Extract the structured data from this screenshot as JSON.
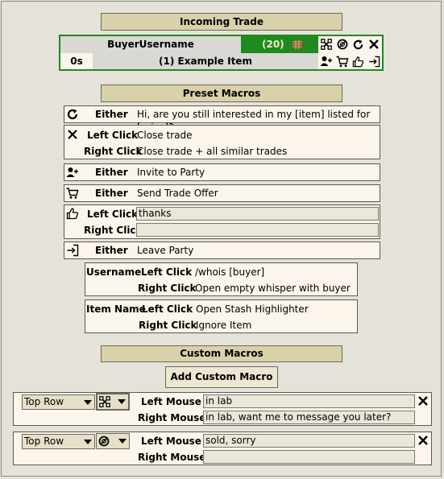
{
  "incoming": {
    "title": "Incoming Trade",
    "buyer": "BuyerUsername",
    "count": "(20)",
    "timer": "0s",
    "item": "(1) Example Item"
  },
  "preset": {
    "title": "Preset Macros",
    "rows": [
      {
        "icon": "refresh-icon",
        "trigger": "Either",
        "text": "Hi, are you still interested in my [item] listed for [price]?"
      },
      {
        "icon": "close-icon",
        "left": "Left Click",
        "left_text": "Close trade",
        "right": "Right Click",
        "right_text": "Close trade + all similar trades"
      },
      {
        "icon": "invite-icon",
        "trigger": "Either",
        "text": "Invite to Party"
      },
      {
        "icon": "cart-icon",
        "trigger": "Either",
        "text": "Send Trade Offer"
      },
      {
        "icon": "thumbs-up-icon",
        "left": "Left Click",
        "left_value": "thanks",
        "right": "Right Click",
        "right_value": ""
      },
      {
        "icon": "leave-icon",
        "trigger": "Either",
        "text": "Leave Party"
      }
    ],
    "username": {
      "label": "Username",
      "left": "Left Click",
      "left_text": "/whois [buyer]",
      "right": "Right Click",
      "right_text": "Open empty whisper with buyer"
    },
    "itemname": {
      "label": "Item Name",
      "left": "Left Click",
      "left_text": "Open Stash Highlighter",
      "right": "Right Click",
      "right_text": "Ignore Item"
    }
  },
  "custom": {
    "title": "Custom Macros",
    "add_label": "Add Custom Macro",
    "rows": [
      {
        "position": "Top Row",
        "icon": "hierarchy-icon",
        "left": "Left Mouse",
        "left_value": "in lab",
        "right": "Right Mouse",
        "right_value": "in lab, want me to message you later?"
      },
      {
        "position": "Top Row",
        "icon": "block-icon",
        "left": "Left Mouse",
        "left_value": "sold, sorry",
        "right": "Right Mouse",
        "right_value": ""
      }
    ]
  },
  "colors": {
    "accent_green": "#1f8a1f",
    "header_tan": "#d9d1aa",
    "panel": "#fbf5ec"
  }
}
